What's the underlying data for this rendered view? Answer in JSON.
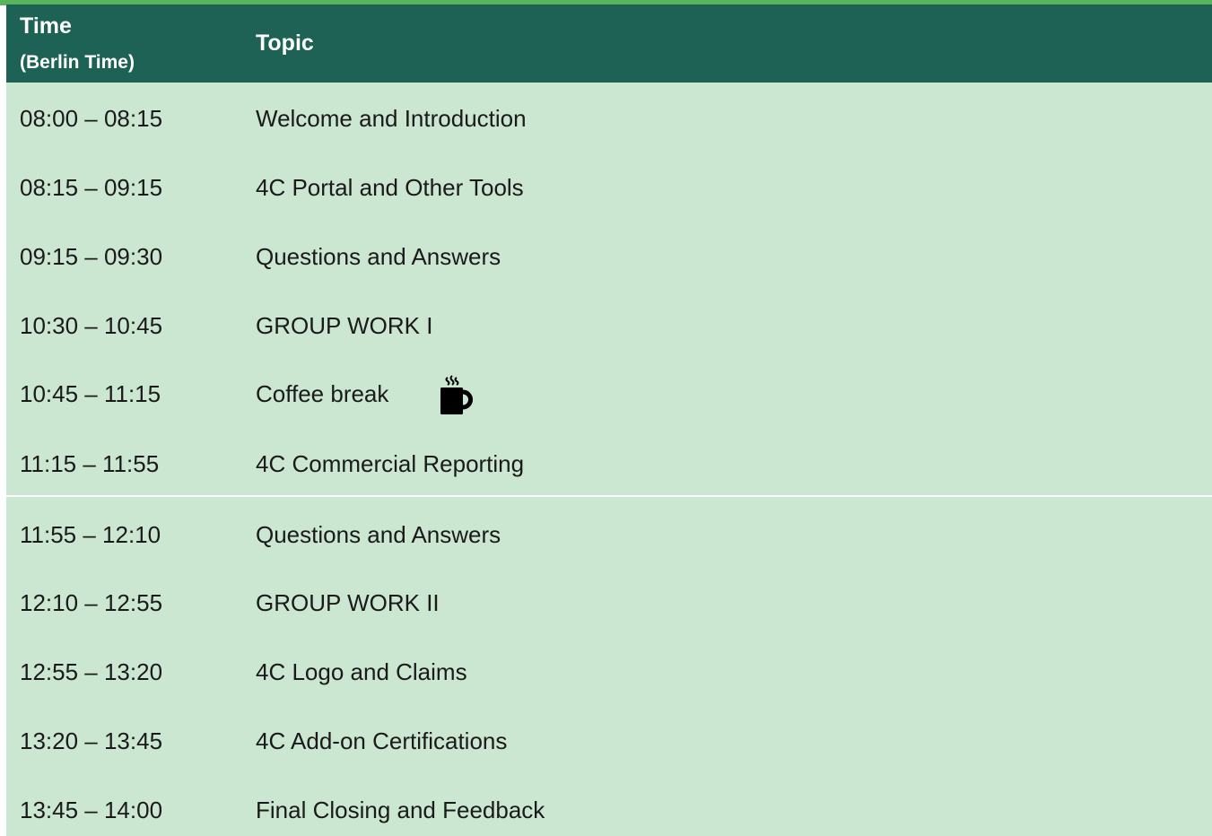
{
  "header": {
    "time_label": "Time",
    "time_sublabel": "(Berlin Time)",
    "topic_label": "Topic"
  },
  "rows": [
    {
      "time": "08:00 – 08:15",
      "topic": "Welcome and Introduction"
    },
    {
      "time": "08:15 – 09:15",
      "topic": "4C Portal and Other Tools"
    },
    {
      "time": "09:15 – 09:30",
      "topic": "Questions and Answers"
    },
    {
      "time": "10:30 – 10:45",
      "topic": "GROUP WORK I"
    },
    {
      "time": "10:45 – 11:15",
      "topic": "Coffee break",
      "icon": "coffee-cup-icon"
    },
    {
      "time": "11:15 – 11:55",
      "topic": "4C Commercial Reporting"
    },
    {
      "time": "11:55 – 12:10",
      "topic": "Questions and Answers"
    },
    {
      "time": "12:10 – 12:55",
      "topic": "GROUP WORK II"
    },
    {
      "time": "12:55 – 13:20",
      "topic": "4C Logo and Claims"
    },
    {
      "time": "13:20 – 13:45",
      "topic": "4C Add-on Certifications"
    },
    {
      "time": "13:45 – 14:00",
      "topic": "Final Closing and Feedback"
    }
  ],
  "colors": {
    "header_bg": "#1e6256",
    "row_bg": "#cce7d1",
    "top_stripe": "#58b45a",
    "text": "#1a1a1a"
  }
}
